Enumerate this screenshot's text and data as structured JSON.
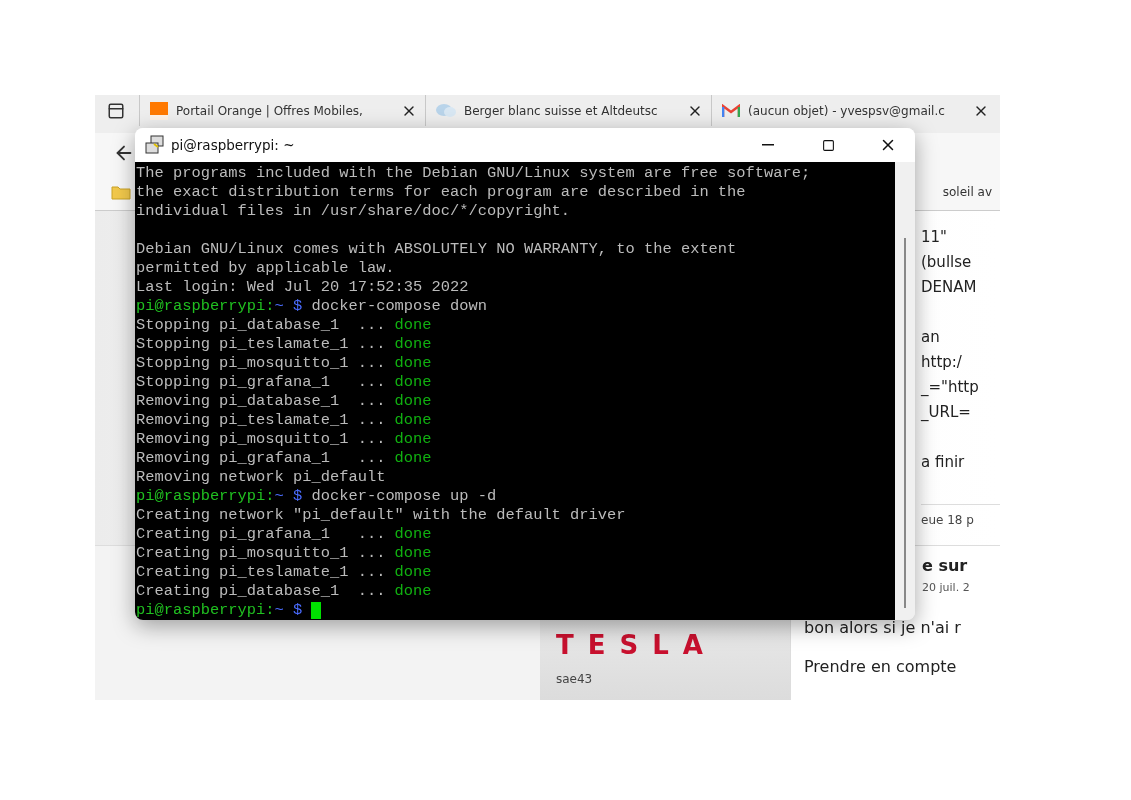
{
  "browser": {
    "tabs": [
      {
        "title": "Portail Orange | Offres Mobiles,"
      },
      {
        "title": "Berger blanc suisse et Altdeutsc"
      },
      {
        "title": "(aucun objet) - yvespsv@gmail.c"
      }
    ],
    "bookmark": "soleil av",
    "post_paragraphs": [
      [
        "11\"",
        "(bullse",
        "DENAM"
      ],
      [
        "an",
        "http:/",
        "_=\"http",
        "_URL="
      ],
      [
        "a finir"
      ]
    ],
    "post_meta": "eue 18 p",
    "reply": {
      "title": "e sur",
      "date": "20 juil. 2",
      "logo": "TESLA",
      "author": "sae43",
      "lines": [
        "bon alors si je n'ai r",
        "Prendre en compte"
      ]
    }
  },
  "terminal": {
    "title": "pi@raspberrypi: ~",
    "lines": [
      {
        "kind": "text",
        "segments": [
          {
            "kind": "output",
            "text": "The programs included with the Debian GNU/Linux system are free software;"
          }
        ]
      },
      {
        "kind": "text",
        "segments": [
          {
            "kind": "output",
            "text": "the exact distribution terms for each program are described in the"
          }
        ]
      },
      {
        "kind": "text",
        "segments": [
          {
            "kind": "output",
            "text": "individual files in /usr/share/doc/*/copyright."
          }
        ]
      },
      {
        "kind": "blank"
      },
      {
        "kind": "text",
        "segments": [
          {
            "kind": "output",
            "text": "Debian GNU/Linux comes with ABSOLUTELY NO WARRANTY, to the extent"
          }
        ]
      },
      {
        "kind": "text",
        "segments": [
          {
            "kind": "output",
            "text": "permitted by applicable law."
          }
        ]
      },
      {
        "kind": "text",
        "segments": [
          {
            "kind": "output",
            "text": "Last login: Wed Jul 20 17:52:35 2022"
          }
        ]
      },
      {
        "kind": "text",
        "segments": [
          {
            "kind": "host",
            "text": "pi@raspberrypi:"
          },
          {
            "kind": "path",
            "text": "~ $"
          },
          {
            "kind": "output",
            "text": " docker-compose down"
          }
        ]
      },
      {
        "kind": "text",
        "segments": [
          {
            "kind": "output",
            "text": "Stopping pi_database_1  ... "
          },
          {
            "kind": "status",
            "text": "done"
          }
        ]
      },
      {
        "kind": "text",
        "segments": [
          {
            "kind": "output",
            "text": "Stopping pi_teslamate_1 ... "
          },
          {
            "kind": "status",
            "text": "done"
          }
        ]
      },
      {
        "kind": "text",
        "segments": [
          {
            "kind": "output",
            "text": "Stopping pi_mosquitto_1 ... "
          },
          {
            "kind": "status",
            "text": "done"
          }
        ]
      },
      {
        "kind": "text",
        "segments": [
          {
            "kind": "output",
            "text": "Stopping pi_grafana_1   ... "
          },
          {
            "kind": "status",
            "text": "done"
          }
        ]
      },
      {
        "kind": "text",
        "segments": [
          {
            "kind": "output",
            "text": "Removing pi_database_1  ... "
          },
          {
            "kind": "status",
            "text": "done"
          }
        ]
      },
      {
        "kind": "text",
        "segments": [
          {
            "kind": "output",
            "text": "Removing pi_teslamate_1 ... "
          },
          {
            "kind": "status",
            "text": "done"
          }
        ]
      },
      {
        "kind": "text",
        "segments": [
          {
            "kind": "output",
            "text": "Removing pi_mosquitto_1 ... "
          },
          {
            "kind": "status",
            "text": "done"
          }
        ]
      },
      {
        "kind": "text",
        "segments": [
          {
            "kind": "output",
            "text": "Removing pi_grafana_1   ... "
          },
          {
            "kind": "status",
            "text": "done"
          }
        ]
      },
      {
        "kind": "text",
        "segments": [
          {
            "kind": "output",
            "text": "Removing network pi_default"
          }
        ]
      },
      {
        "kind": "text",
        "segments": [
          {
            "kind": "host",
            "text": "pi@raspberrypi:"
          },
          {
            "kind": "path",
            "text": "~ $"
          },
          {
            "kind": "output",
            "text": " docker-compose up -d"
          }
        ]
      },
      {
        "kind": "text",
        "segments": [
          {
            "kind": "output",
            "text": "Creating network \"pi_default\" with the default driver"
          }
        ]
      },
      {
        "kind": "text",
        "segments": [
          {
            "kind": "output",
            "text": "Creating pi_grafana_1   ... "
          },
          {
            "kind": "status",
            "text": "done"
          }
        ]
      },
      {
        "kind": "text",
        "segments": [
          {
            "kind": "output",
            "text": "Creating pi_mosquitto_1 ... "
          },
          {
            "kind": "status",
            "text": "done"
          }
        ]
      },
      {
        "kind": "text",
        "segments": [
          {
            "kind": "output",
            "text": "Creating pi_teslamate_1 ... "
          },
          {
            "kind": "status",
            "text": "done"
          }
        ]
      },
      {
        "kind": "text",
        "segments": [
          {
            "kind": "output",
            "text": "Creating pi_database_1  ... "
          },
          {
            "kind": "status",
            "text": "done"
          }
        ]
      },
      {
        "kind": "text",
        "segments": [
          {
            "kind": "host",
            "text": "pi@raspberrypi:"
          },
          {
            "kind": "path",
            "text": "~ $"
          }
        ],
        "cursor": true
      }
    ]
  }
}
